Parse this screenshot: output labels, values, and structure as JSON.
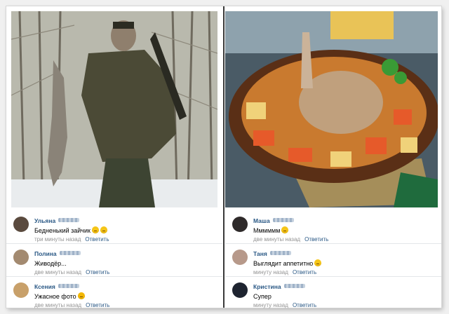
{
  "left": {
    "comments": [
      {
        "name": "Ульяна",
        "text": "Бедненький зайчик",
        "emoji": [
          "tearful-face",
          "tearful-face"
        ],
        "time": "три минуты назад",
        "reply": "Ответить"
      },
      {
        "name": "Полина",
        "text": "Живодёр...",
        "emoji": [],
        "time": "две минуты назад",
        "reply": "Ответить"
      },
      {
        "name": "Ксения",
        "text": "Ужасное фото",
        "emoji": [
          "sad-face"
        ],
        "time": "две минуты назад",
        "reply": "Ответить"
      }
    ]
  },
  "right": {
    "comments": [
      {
        "name": "Маша",
        "text": "Мммммм",
        "emoji": [
          "smiling-face"
        ],
        "time": "две минуты назад",
        "reply": "Ответить"
      },
      {
        "name": "Таня",
        "text": "Выглядит аппетитно",
        "emoji": [
          "yum-face"
        ],
        "time": "минуту назад",
        "reply": "Ответить"
      },
      {
        "name": "Кристина",
        "text": "Супер",
        "emoji": [],
        "time": "минуту назад",
        "reply": "Ответить"
      }
    ]
  }
}
